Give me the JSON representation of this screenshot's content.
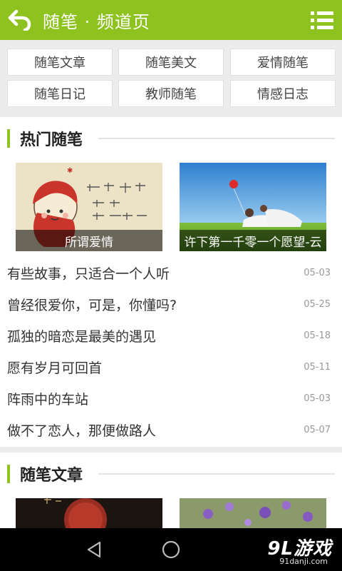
{
  "header": {
    "title": "随笔 · 频道页",
    "back_icon": "back-arrow-icon",
    "menu_icon": "list-menu-icon",
    "color": "#8dc21f"
  },
  "categories": [
    "随笔文章",
    "随笔美文",
    "爱情随笔",
    "随笔日记",
    "教师随笔",
    "情感日志"
  ],
  "hot_section": {
    "title": "热门随笔",
    "featured": [
      {
        "caption": "所谓爱情"
      },
      {
        "caption": "许下第一千零一个愿望-云"
      }
    ],
    "items": [
      {
        "title": "有些故事，只适合一个人听",
        "date": "05-03"
      },
      {
        "title": "曾经很爱你，可是，你懂吗?",
        "date": "05-25"
      },
      {
        "title": "孤独的暗恋是最美的遇见",
        "date": "05-18"
      },
      {
        "title": "愿有岁月可回首",
        "date": "05-11"
      },
      {
        "title": "阵雨中的车站",
        "date": "05-03"
      },
      {
        "title": "做不了恋人，那便做路人",
        "date": "05-07"
      }
    ]
  },
  "article_section": {
    "title": "随笔文章"
  },
  "navbar": {
    "back_icon": "triangle-back-icon",
    "home_icon": "circle-home-icon",
    "watermark": "9L游戏",
    "watermark_sub": "91danji.com"
  }
}
